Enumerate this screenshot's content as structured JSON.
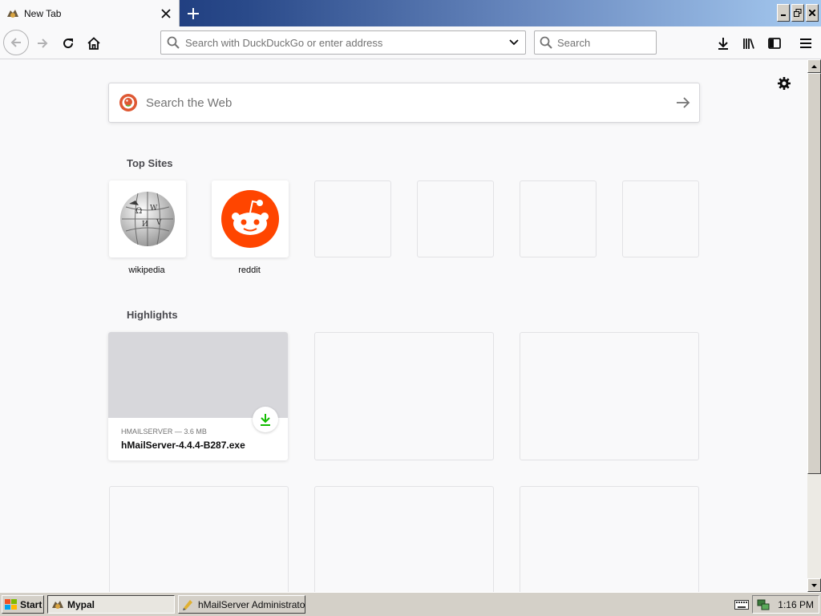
{
  "tab": {
    "title": "New Tab"
  },
  "navbar": {
    "url_placeholder": "Search with DuckDuckGo or enter address",
    "search_placeholder": "Search"
  },
  "content": {
    "websearch_placeholder": "Search the Web",
    "top_sites_title": "Top Sites",
    "top_sites": [
      {
        "label": "wikipedia",
        "icon": "wikipedia-globe-icon"
      },
      {
        "label": "reddit",
        "icon": "reddit-alien-icon"
      },
      {
        "label": ""
      },
      {
        "label": ""
      },
      {
        "label": ""
      },
      {
        "label": ""
      }
    ],
    "highlights_title": "Highlights",
    "highlights": [
      {
        "meta": "hMailServer — 3.6 MB",
        "filename": "hMailServer-4.4.4-B287.exe",
        "icon": "download-icon"
      }
    ]
  },
  "taskbar": {
    "start_label": "Start",
    "tasks": [
      {
        "label": "Mypal",
        "active": true
      },
      {
        "label": "hMailServer Administrato...",
        "active": false
      }
    ],
    "clock": "1:16 PM"
  },
  "colors": {
    "reddit": "#ff4500",
    "download_green": "#12bc00",
    "titlebar_start": "#0a246a",
    "titlebar_end": "#a6caf0",
    "win_face": "#d4d0c8"
  }
}
